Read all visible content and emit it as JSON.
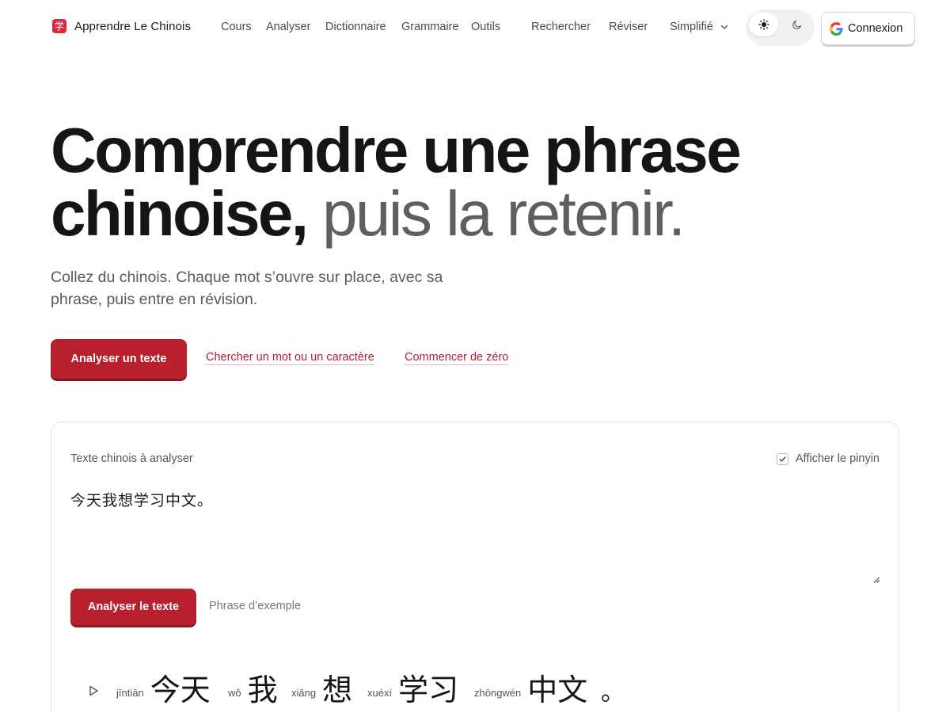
{
  "brand": {
    "logo_glyph": "学",
    "name": "Apprendre Le Chinois"
  },
  "nav": {
    "items": [
      "Cours",
      "Analyser",
      "Dictionnaire",
      "Grammaire",
      "Outils",
      "Rechercher",
      "Réviser"
    ],
    "script_select": "Simplifié",
    "theme": {
      "active": "light"
    },
    "login_label": "Connexion"
  },
  "hero": {
    "title_main": "Comprendre une phrase chinoise,",
    "title_muted": "puis la retenir.",
    "subtitle": "Collez du chinois. Chaque mot s’ouvre sur place, avec sa phrase, puis entre en révision.",
    "cta_primary": "Analyser un texte",
    "cta_link_1": "Chercher un mot ou un caractère",
    "cta_link_2": "Commencer de zéro"
  },
  "analyzer": {
    "label": "Texte chinois à analyser",
    "pinyin_toggle_label": "Afficher le pinyin",
    "pinyin_checked": true,
    "input_value": "今天我想学习中文。",
    "analyze_button": "Analyser le texte",
    "example_link": "Phrase d’exemple",
    "tokens": [
      {
        "pinyin": "jīntiān",
        "hanzi": "今天"
      },
      {
        "pinyin": "wǒ",
        "hanzi": "我"
      },
      {
        "pinyin": "xiǎng",
        "hanzi": "想"
      },
      {
        "pinyin": "xuéxí",
        "hanzi": "学习"
      },
      {
        "pinyin": "zhōngwén",
        "hanzi": "中文"
      }
    ],
    "punctuation": "。"
  },
  "colors": {
    "accent": "#b8202d",
    "text": "#151515",
    "muted": "#5f5f5f"
  },
  "icons": [
    "google-icon",
    "sun-icon",
    "moon-icon",
    "chevron-down-icon",
    "check-icon",
    "play-icon"
  ]
}
